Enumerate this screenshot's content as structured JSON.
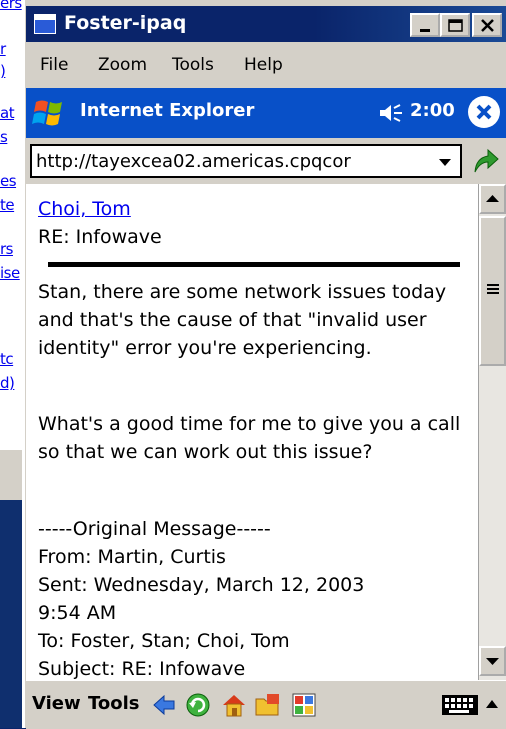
{
  "background": {
    "fragments": [
      "ers",
      "r",
      ")",
      "at",
      "s",
      "es",
      "te",
      "rs",
      "ise",
      "tc",
      "d)"
    ]
  },
  "window": {
    "title": "Foster-ipaq",
    "menu": [
      "File",
      "Zoom",
      "Tools",
      "Help"
    ]
  },
  "ie": {
    "title": "Internet Explorer",
    "time": "2:00",
    "address": "http://tayexcea02.americas.cpqcor"
  },
  "message": {
    "sender": "Choi, Tom",
    "subject": "RE: Infowave",
    "body1": "Stan, there are some network issues today and that's the cause of that \"invalid user identity\" error you're experiencing.",
    "body2": "What's a good time for me to give you a call so that we can work out this issue?",
    "orig_header": "-----Original Message-----",
    "from": "From: Martin, Curtis",
    "sent": "Sent: Wednesday, March 12, 2003",
    "sent_time": "9:54 AM",
    "to": "To: Foster, Stan; Choi, Tom",
    "subject_line": "Subject: RE: Infowave"
  },
  "toolbar": {
    "view": "View",
    "tools": "Tools"
  },
  "colors": {
    "title_bar": "#0a246a",
    "ie_bar": "#0850c8",
    "link": "#0000ee"
  }
}
